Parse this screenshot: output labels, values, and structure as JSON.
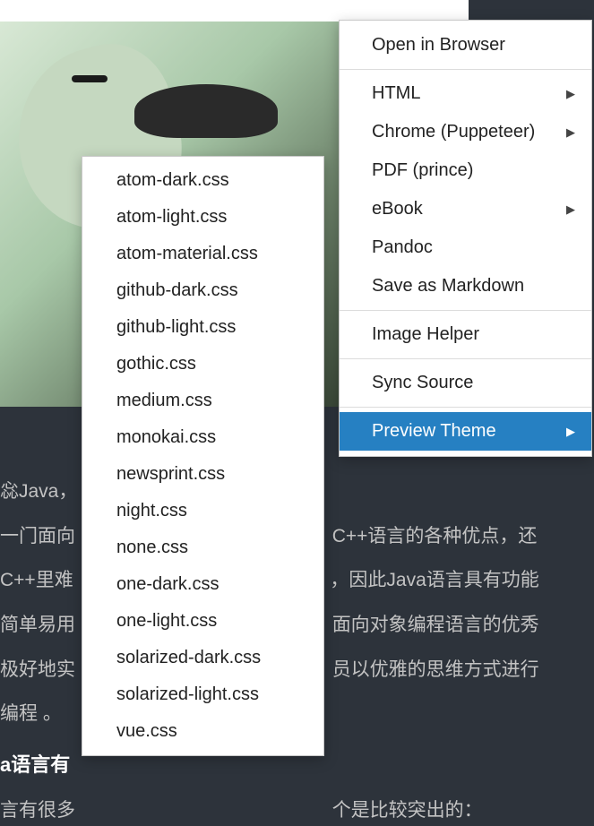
{
  "background": {
    "partial_text_1": "惢Java，",
    "paragraph_1": "一门面向",
    "paragraph_1b": "C++语言的各种优点，还",
    "paragraph_2": "C++里难",
    "paragraph_2b": "，因此Java语言具有功能",
    "paragraph_3": "简单易用",
    "paragraph_3b": "面向对象编程语言的优秀",
    "paragraph_4": "极好地实",
    "paragraph_4b": "员以优雅的思维方式进行",
    "paragraph_5": "编程 。",
    "heading": "a语言有",
    "paragraph_6": "言有很多",
    "paragraph_6b": "个是比较突出的："
  },
  "mainmenu": {
    "items": [
      {
        "label": "Open in Browser",
        "has_submenu": false,
        "selected": false
      },
      {
        "separator": true
      },
      {
        "label": "HTML",
        "has_submenu": true,
        "selected": false
      },
      {
        "label": "Chrome (Puppeteer)",
        "has_submenu": true,
        "selected": false
      },
      {
        "label": "PDF (prince)",
        "has_submenu": false,
        "selected": false
      },
      {
        "label": "eBook",
        "has_submenu": true,
        "selected": false
      },
      {
        "label": "Pandoc",
        "has_submenu": false,
        "selected": false
      },
      {
        "label": "Save as Markdown",
        "has_submenu": false,
        "selected": false
      },
      {
        "separator": true
      },
      {
        "label": "Image Helper",
        "has_submenu": false,
        "selected": false
      },
      {
        "separator": true
      },
      {
        "label": "Sync Source",
        "has_submenu": false,
        "selected": false
      },
      {
        "separator": true
      },
      {
        "label": "Preview Theme",
        "has_submenu": true,
        "selected": true
      }
    ]
  },
  "submenu": {
    "items": [
      "atom-dark.css",
      "atom-light.css",
      "atom-material.css",
      "github-dark.css",
      "github-light.css",
      "gothic.css",
      "medium.css",
      "monokai.css",
      "newsprint.css",
      "night.css",
      "none.css",
      "one-dark.css",
      "one-light.css",
      "solarized-dark.css",
      "solarized-light.css",
      "vue.css"
    ]
  }
}
